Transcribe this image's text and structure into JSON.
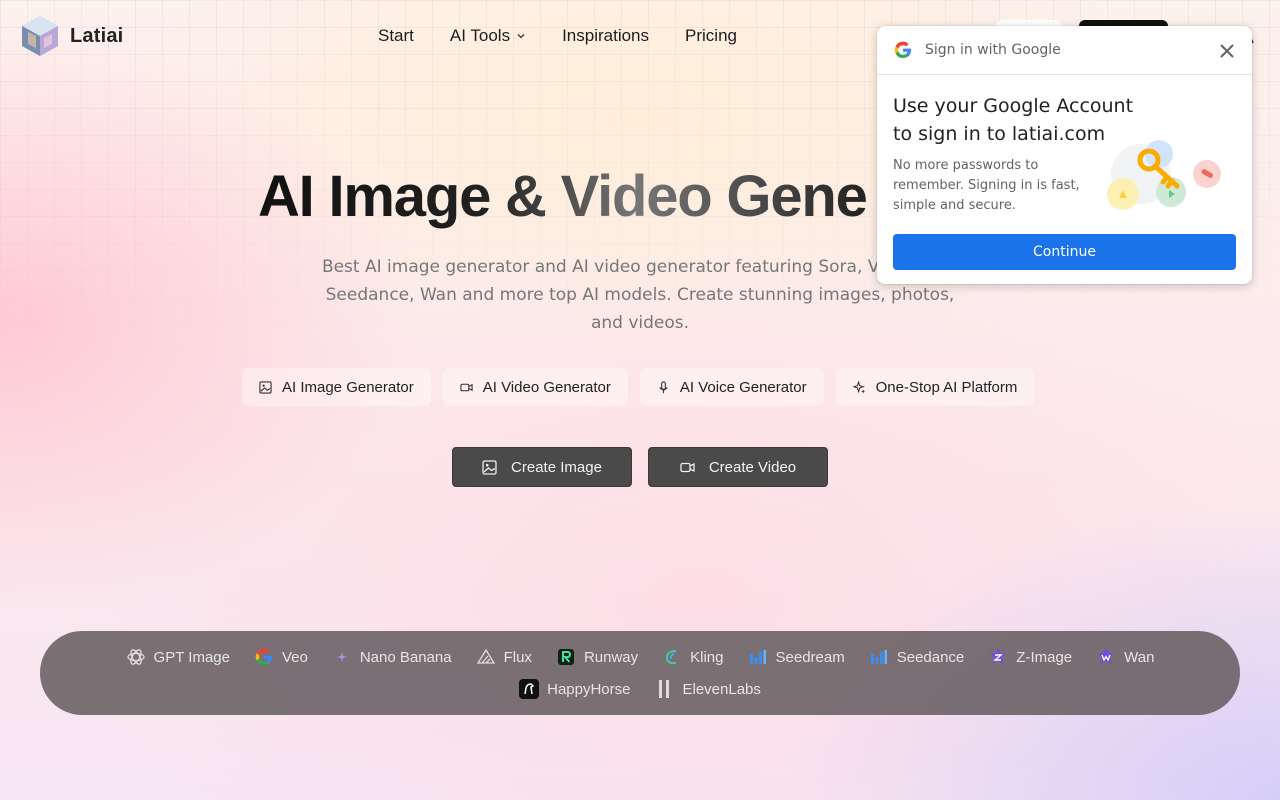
{
  "brand": {
    "name": "Latiai"
  },
  "nav": {
    "items": [
      {
        "label": "Start",
        "has_dropdown": false
      },
      {
        "label": "AI Tools",
        "has_dropdown": true
      },
      {
        "label": "Inspirations",
        "has_dropdown": false
      },
      {
        "label": "Pricing",
        "has_dropdown": false
      }
    ]
  },
  "hero": {
    "title": "AI Image & Video Gene",
    "subtitle": "Best AI image generator and AI video generator featuring Sora, V  Banana, Seedance, Wan and more top AI models. Create stunning images, photos, and videos."
  },
  "feature_pills": [
    {
      "label": "AI Image Generator",
      "icon": "image-icon"
    },
    {
      "label": "AI Video Generator",
      "icon": "video-icon"
    },
    {
      "label": "AI Voice Generator",
      "icon": "mic-icon"
    },
    {
      "label": "One-Stop AI Platform",
      "icon": "sparkle-icon"
    }
  ],
  "cta": {
    "create_image": "Create Image",
    "create_video": "Create Video"
  },
  "models": {
    "row1": [
      {
        "label": "GPT Image",
        "icon": "openai-icon"
      },
      {
        "label": "Veo",
        "icon": "google-icon"
      },
      {
        "label": "Nano Banana",
        "icon": "sparkle-icon"
      },
      {
        "label": "Flux",
        "icon": "flux-icon"
      },
      {
        "label": "Runway",
        "icon": "runway-icon"
      },
      {
        "label": "Kling",
        "icon": "kling-icon"
      },
      {
        "label": "Seedream",
        "icon": "bars-icon"
      },
      {
        "label": "Seedance",
        "icon": "bars-icon"
      },
      {
        "label": "Z-Image",
        "icon": "star-icon"
      },
      {
        "label": "Wan",
        "icon": "star-icon"
      }
    ],
    "row2": [
      {
        "label": "HappyHorse",
        "icon": "horse-icon"
      },
      {
        "label": "ElevenLabs",
        "icon": "elevenlabs-icon"
      }
    ]
  },
  "google_popup": {
    "header": "Sign in with Google",
    "title": "Use your Google Account to sign in to latiai.com",
    "description": "No more passwords to remember. Signing in is fast, simple and secure.",
    "continue_label": "Continue"
  },
  "colors": {
    "google_blue": "#1a73e8",
    "cta_bg": "#4a4a4a",
    "models_strip_bg": "#645c5f"
  }
}
